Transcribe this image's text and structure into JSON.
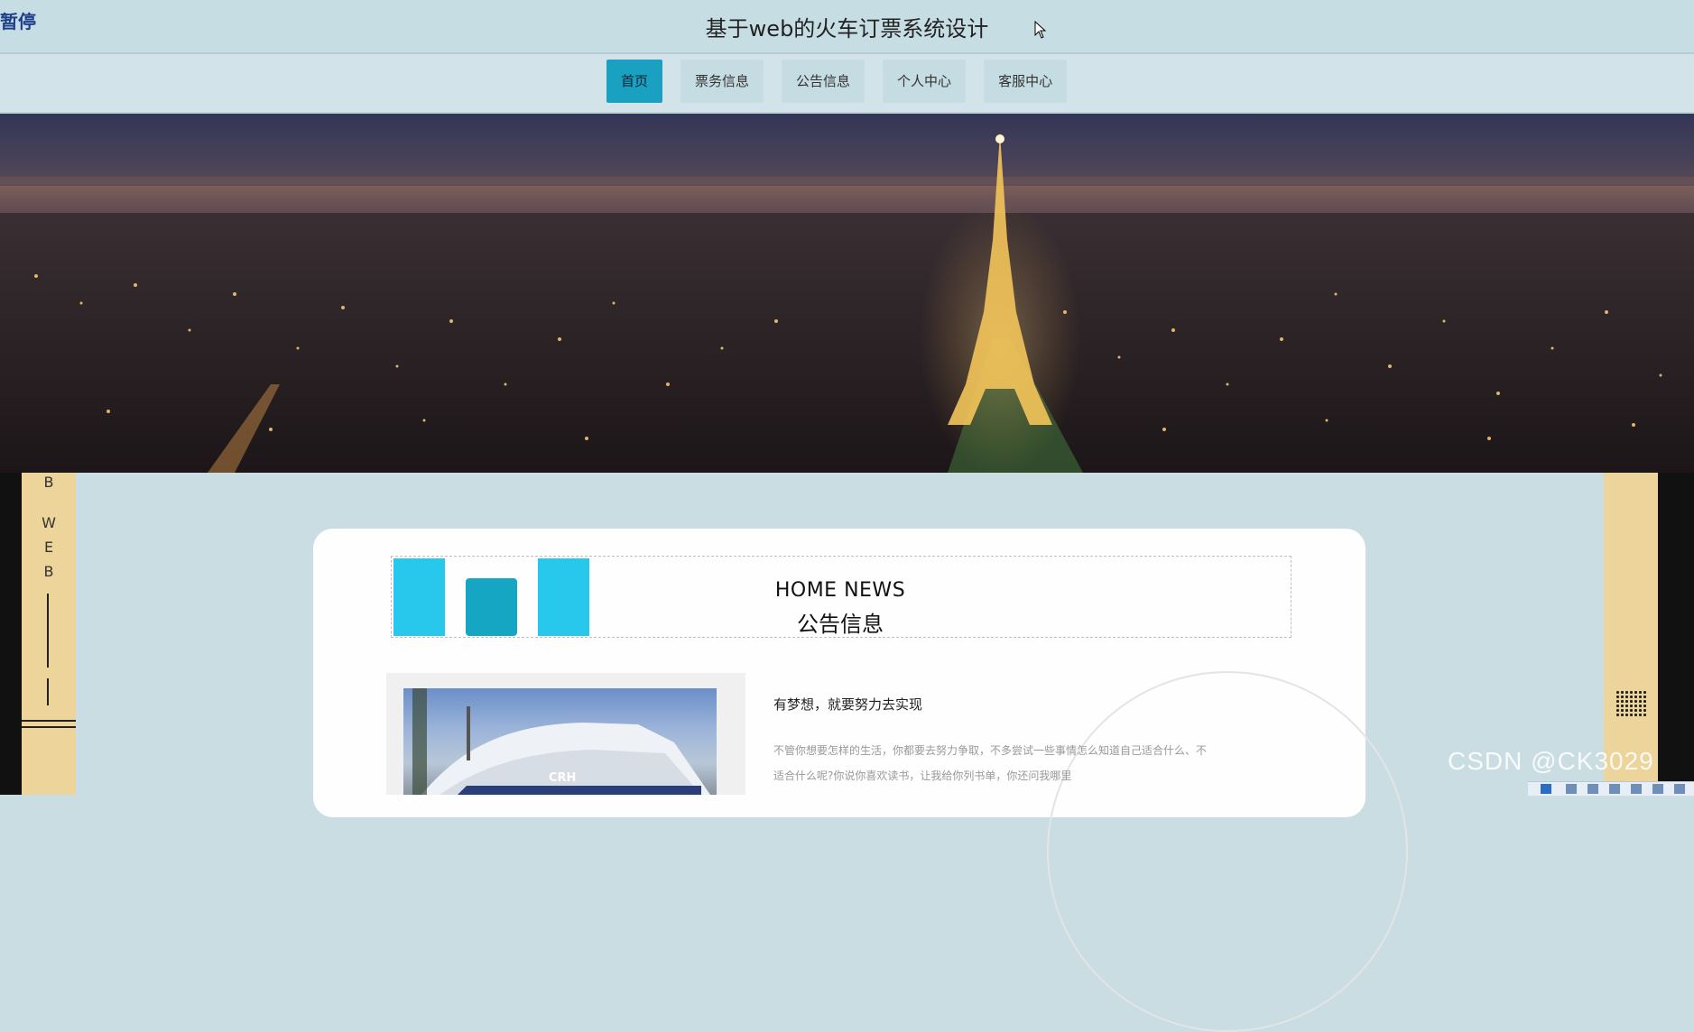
{
  "header": {
    "pause_label": "暂停",
    "title": "基于web的火车订票系统设计"
  },
  "nav": {
    "items": [
      {
        "label": "首页"
      },
      {
        "label": "票务信息"
      },
      {
        "label": "公告信息"
      },
      {
        "label": "个人中心"
      },
      {
        "label": "客服中心"
      }
    ]
  },
  "side_decor": {
    "letters": [
      "B",
      "W",
      "E",
      "B"
    ]
  },
  "news": {
    "title_en": "HOME NEWS",
    "title_cn": "公告信息"
  },
  "article": {
    "title": "有梦想，就要努力去实现",
    "body": "不管你想要怎样的生活，你都要去努力争取，不多尝试一些事情怎么知道自己适合什么、不适合什么呢?你说你喜欢读书，让我给你列书单，你还问我哪里",
    "image_label": "CRH"
  },
  "watermark": "CSDN @CK3029",
  "colors": {
    "page_bg": "#c9dde3",
    "nav_active": "#1aa1c2",
    "accent_square": "#27c8ec",
    "side_panel": "#ecd49a"
  }
}
